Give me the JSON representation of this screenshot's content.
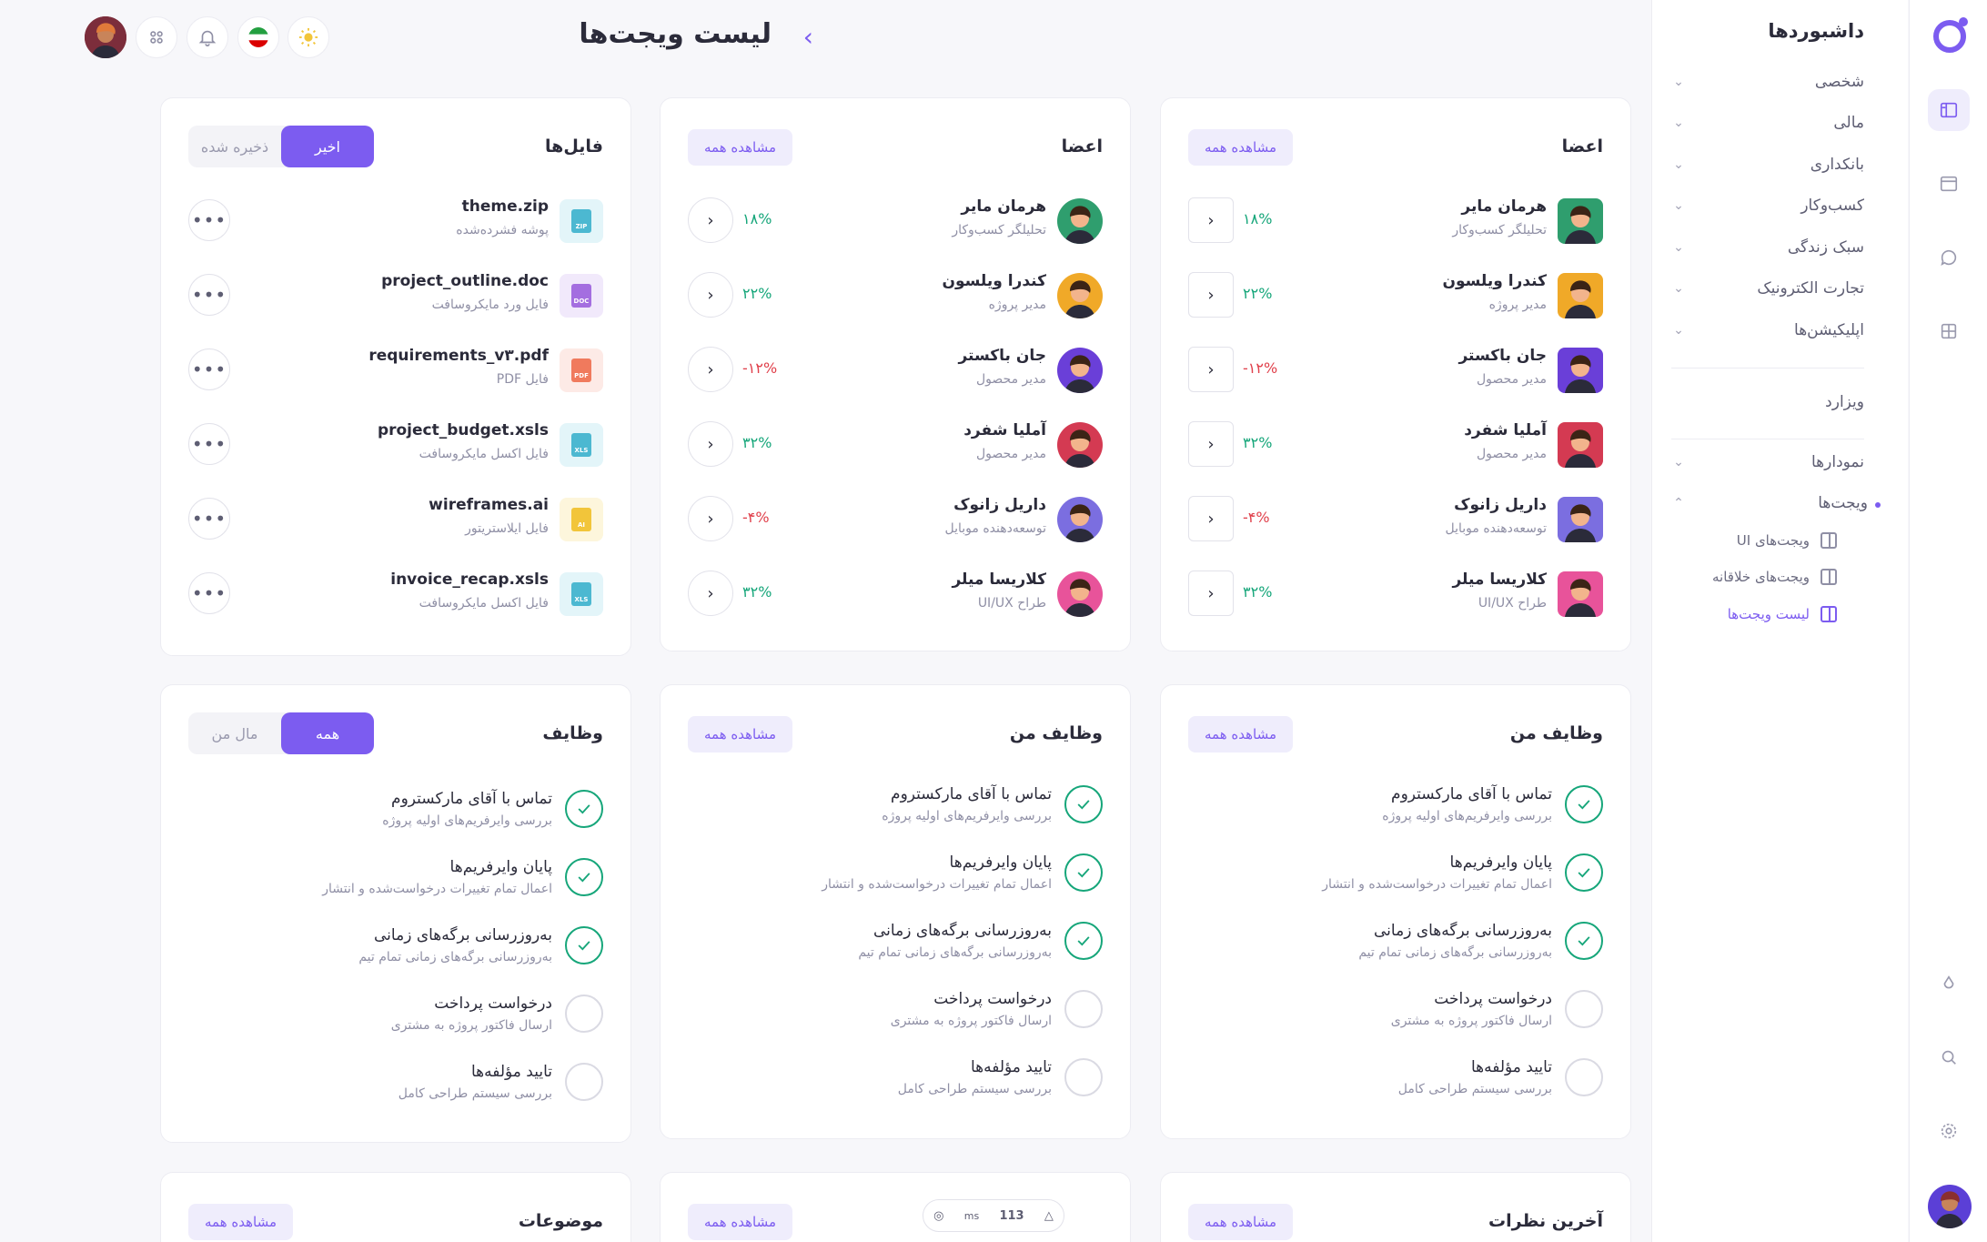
{
  "header": {
    "title": "لیست ویجت‌ها"
  },
  "sidebar": {
    "title": "داشبوردها",
    "items": [
      {
        "label": "شخصی"
      },
      {
        "label": "مالی"
      },
      {
        "label": "بانکداری"
      },
      {
        "label": "کسب‌وکار"
      },
      {
        "label": "سبک زندگی"
      },
      {
        "label": "تجارت الکترونیک"
      },
      {
        "label": "اپلیکیشن‌ها"
      }
    ],
    "wizard": "ویزارد",
    "charts": "نمودارها",
    "widgets": "ویجت‌ها",
    "sub_items": [
      {
        "label": "ویجت‌های UI"
      },
      {
        "label": "ویجت‌های خلاقانه"
      },
      {
        "label": "لیست ویجت‌ها"
      }
    ]
  },
  "members_card": {
    "title": "اعضا",
    "view_all": "مشاهده همه",
    "members": [
      {
        "name": "هرمان مایر",
        "role": "تحلیلگر کسب‌وکار",
        "pct": "۱۸%",
        "trend": "pos",
        "color": "#2f9e6e"
      },
      {
        "name": "کندرا ویلسون",
        "role": "مدیر پروژه",
        "pct": "۲۲%",
        "trend": "pos",
        "color": "#f0a928"
      },
      {
        "name": "جان باکستر",
        "role": "مدیر محصول",
        "pct": "۱۲%-",
        "trend": "neg",
        "color": "#6a3fd8"
      },
      {
        "name": "آملیا شفرد",
        "role": "مدیر محصول",
        "pct": "۳۲%",
        "trend": "pos",
        "color": "#d43a52"
      },
      {
        "name": "داریل زانوک",
        "role": "توسعه‌دهنده موبایل",
        "pct": "۴%-",
        "trend": "neg",
        "color": "#7b6ee0"
      },
      {
        "name": "کلاریسا میلر",
        "role": "طراح UI/UX",
        "pct": "۳۲%",
        "trend": "pos",
        "color": "#e8539a"
      }
    ]
  },
  "files_card": {
    "title": "فایل‌ها",
    "tab_active": "اخیر",
    "tab_inactive": "ذخیره شده",
    "files": [
      {
        "name": "theme.zip",
        "desc": "پوشه فشرده‌شده",
        "type": "ZIP",
        "bg": "#e3f5f9",
        "fg": "#4cb8d1"
      },
      {
        "name": "project_outline.doc",
        "desc": "فایل ورد مایکروسافت",
        "type": "DOC",
        "bg": "#f1e9fb",
        "fg": "#a46ee0"
      },
      {
        "name": "requirements_v۳.pdf",
        "desc": "فایل PDF",
        "type": "PDF",
        "bg": "#fdeae6",
        "fg": "#f07a5d"
      },
      {
        "name": "project_budget.xsls",
        "desc": "فایل اکسل مایکروسافت",
        "type": "XLS",
        "bg": "#e3f5f9",
        "fg": "#4cb8d1"
      },
      {
        "name": "wireframes.ai",
        "desc": "فایل ایلاستریتور",
        "type": "AI",
        "bg": "#fdf6dc",
        "fg": "#f2c53a"
      },
      {
        "name": "invoice_recap.xsls",
        "desc": "فایل اکسل مایکروسافت",
        "type": "XLS",
        "bg": "#e3f5f9",
        "fg": "#4cb8d1"
      }
    ]
  },
  "tasks_card": {
    "title": "وظایف من",
    "view_all": "مشاهده همه",
    "tasks": [
      {
        "title": "تماس با آقای مارکستروم",
        "sub": "بررسی وایرفریم‌های اولیه پروژه",
        "done": true
      },
      {
        "title": "پایان وایرفریم‌ها",
        "sub": "اعمال تمام تغییرات درخواست‌شده و انتشار",
        "done": true
      },
      {
        "title": "به‌روزرسانی برگه‌های زمانی",
        "sub": "به‌روزرسانی برگه‌های زمانی تمام تیم",
        "done": true
      },
      {
        "title": "درخواست پرداخت",
        "sub": "ارسال فاکتور پروژه به مشتری",
        "done": false
      },
      {
        "title": "تایید مؤلفه‌ها",
        "sub": "بررسی سیستم طراحی کامل",
        "done": false
      }
    ]
  },
  "tasks_card_tabs": {
    "title": "وظایف",
    "tab_active": "همه",
    "tab_inactive": "مال من"
  },
  "bottom_cards": {
    "comments_title": "آخرین نظرات",
    "topics_title": "موضوعات",
    "view_all": "مشاهده همه"
  },
  "perf": {
    "value": "113",
    "unit": "ms"
  },
  "colors": {
    "accent": "#7c5cf0",
    "positive": "#16a67a",
    "negative": "#e0404b"
  }
}
